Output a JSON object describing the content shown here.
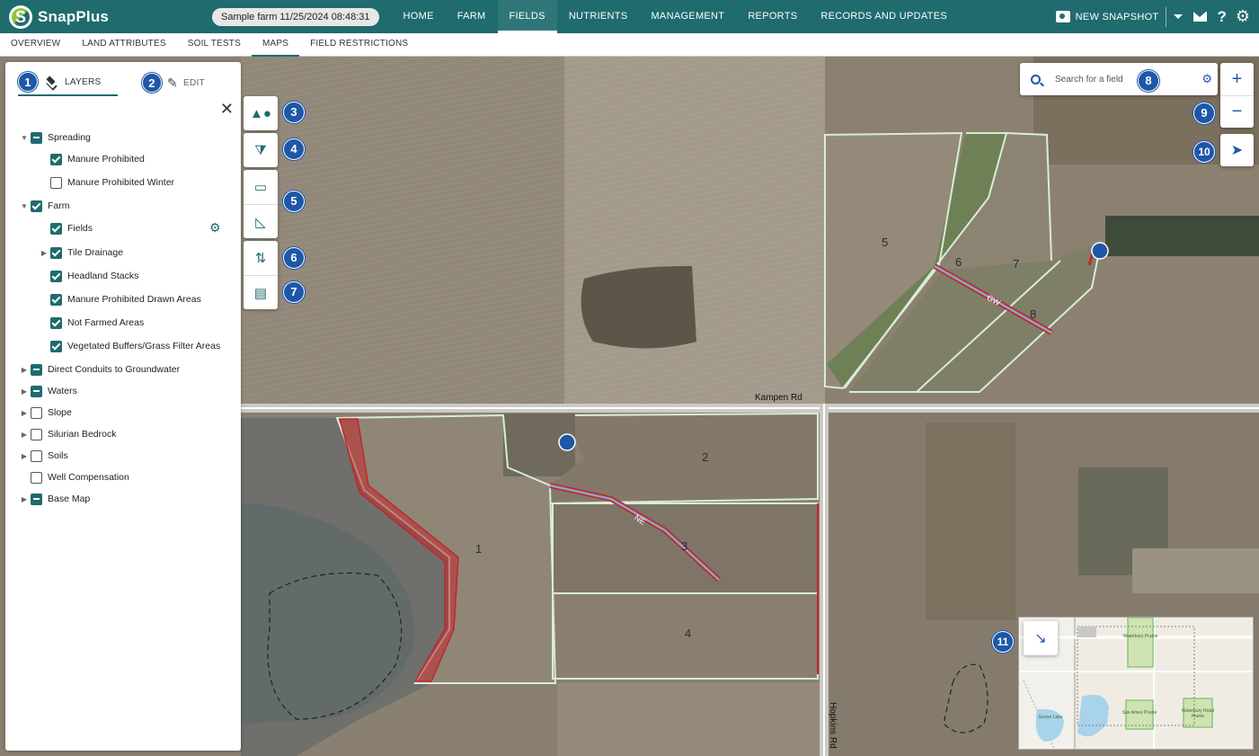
{
  "app": {
    "name": "SnapPlus",
    "snapshot": "Sample farm 11/25/2024 08:48:31"
  },
  "nav": {
    "items": [
      "HOME",
      "FARM",
      "FIELDS",
      "NUTRIENTS",
      "MANAGEMENT",
      "REPORTS",
      "RECORDS AND UPDATES"
    ],
    "active": "FIELDS",
    "new_snapshot": "NEW SNAPSHOT"
  },
  "subnav": {
    "items": [
      "OVERVIEW",
      "LAND ATTRIBUTES",
      "SOIL TESTS",
      "MAPS",
      "FIELD RESTRICTIONS"
    ],
    "active": "MAPS"
  },
  "panel": {
    "tabs": {
      "layers": "LAYERS",
      "edit": "EDIT"
    },
    "layers": [
      {
        "label": "Spreading",
        "state": "partial",
        "expander": "open"
      },
      {
        "label": "Manure Prohibited",
        "state": "checked"
      },
      {
        "label": "Manure Prohibited Winter",
        "state": "empty"
      },
      {
        "label": "Farm",
        "state": "checked",
        "expander": "open"
      },
      {
        "label": "Fields",
        "state": "checked"
      },
      {
        "label": "Tile Drainage",
        "state": "checked",
        "expander": "closed"
      },
      {
        "label": "Headland Stacks",
        "state": "checked"
      },
      {
        "label": "Manure Prohibited Drawn Areas",
        "state": "checked"
      },
      {
        "label": "Not Farmed Areas",
        "state": "checked"
      },
      {
        "label": "Vegetated Buffers/Grass Filter Areas",
        "state": "checked"
      },
      {
        "label": "Direct Conduits to Groundwater",
        "state": "partial",
        "expander": "closed"
      },
      {
        "label": "Waters",
        "state": "partial",
        "expander": "closed"
      },
      {
        "label": "Slope",
        "state": "empty",
        "expander": "closed"
      },
      {
        "label": "Silurian Bedrock",
        "state": "empty",
        "expander": "closed"
      },
      {
        "label": "Soils",
        "state": "empty",
        "expander": "closed"
      },
      {
        "label": "Well Compensation",
        "state": "empty"
      },
      {
        "label": "Base Map",
        "state": "partial",
        "expander": "closed"
      }
    ]
  },
  "search": {
    "placeholder": "Search for a field"
  },
  "callouts": [
    "1",
    "2",
    "3",
    "4",
    "5",
    "6",
    "7",
    "8",
    "9",
    "10",
    "11"
  ],
  "map": {
    "field_labels": [
      "1",
      "2",
      "3",
      "4",
      "5",
      "6",
      "7",
      "8"
    ],
    "waterway_labels": [
      "GW",
      "NE"
    ],
    "roads": {
      "east_west": "Kampen Rd",
      "north_south": "Hopkins Rd"
    },
    "minimap_labels": [
      "Waterbury Prairie",
      "Sue Ames Prairie",
      "Waterbury Road Prairie",
      "Goose Lake"
    ]
  },
  "colors": {
    "brand": "#1f6b6e",
    "callout": "#1e57a8",
    "restricted": "#c0282d",
    "field_outline": "#d8ecd8"
  }
}
